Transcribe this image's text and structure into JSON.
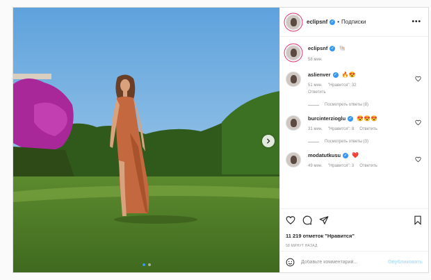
{
  "header": {
    "username": "eclipsnf",
    "separator": "•",
    "follow_label": "Подписки",
    "more_label": "•••"
  },
  "caption": {
    "username": "eclipsnf",
    "emoji": "🐚",
    "time": "58 мин."
  },
  "comments": [
    {
      "username": "aslienver",
      "emoji": "🔥😍",
      "time": "51 мин.",
      "likes": "\"Нравится\": 32",
      "reply_label": "Ответить",
      "view_replies": "Посмотреть ответы (8)"
    },
    {
      "username": "burcinterzioglu",
      "emoji": "😍😍😍",
      "time": "31 мин.",
      "likes": "\"Нравится\": 8",
      "reply_label": "Ответить",
      "view_replies": "Посмотреть ответы (3)"
    },
    {
      "username": "modatutkusu",
      "emoji": "❤️",
      "time": "49 мин.",
      "likes": "\"Нравится\": 3",
      "reply_label": "Ответить"
    }
  ],
  "actions": {
    "likes_count": "11 219 отметок \"Нравится\"",
    "posted_ago": "58 МИНУТ НАЗАД"
  },
  "add_comment": {
    "placeholder": "Добавьте комментарий...",
    "publish_label": "Опубликовать"
  },
  "carousel": {
    "slide_count": 2,
    "active_index": 0
  },
  "colors": {
    "link_blue": "#3897f0",
    "publish_disabled": "#b2dffc",
    "muted": "#8e8e8e",
    "heart_red": "#ed4956"
  }
}
